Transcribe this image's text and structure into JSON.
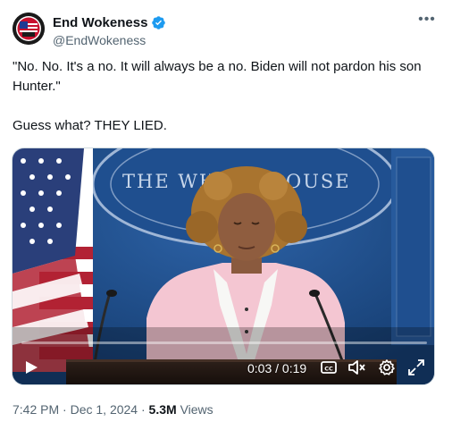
{
  "author": {
    "display_name": "End Wokeness",
    "handle": "@EndWokeness",
    "verified": true
  },
  "tweet": {
    "line1": "\"No. No. It's a no. It will always be a no. Biden will not pardon his son Hunter.\"",
    "line2": "Guess what? THEY LIED."
  },
  "media": {
    "kind": "video",
    "backdrop_text": "THE WHITE HOUSE",
    "backdrop_text_visible": "THE WH",
    "backdrop_text_visible_right": "OUSE",
    "time_display": "0:03 / 0:19",
    "progress_fraction": 0.0,
    "controls": [
      "play-icon",
      "captions-icon",
      "mute-icon",
      "settings-icon",
      "fullscreen-icon"
    ]
  },
  "footer": {
    "time": "7:42 PM",
    "separator": "·",
    "date": "Dec 1, 2024",
    "views_count": "5.3M",
    "views_label": "Views"
  },
  "colors": {
    "text_primary": "#0f1419",
    "text_secondary": "#536471",
    "verified_blue": "#1d9bf0",
    "backdrop_blue": "#1d4b86"
  }
}
